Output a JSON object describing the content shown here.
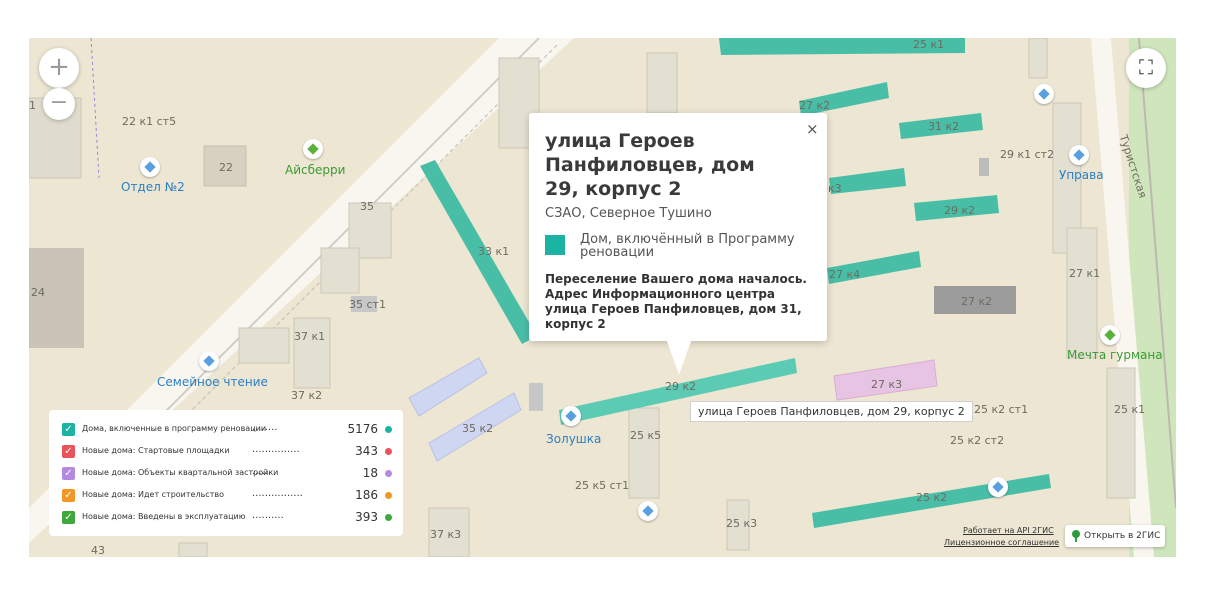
{
  "popup": {
    "title": "улица Героев Панфиловцев, дом 29, корпус 2",
    "district": "СЗАО, Северное Тушино",
    "status": "Дом, включённый в Программу реновации",
    "info": "Переселение Вашего дома началось. Адрес Информационного центра улица Героев Панфиловцев, дом 31, корпус 2",
    "close_label": "×",
    "swatch_color": "#1bb3a4"
  },
  "hover_label": "улица Героев Панфиловцев, дом 29, корпус 2",
  "controls": {
    "zoom_in": "+",
    "zoom_out": "−",
    "fullscreen": "⛶"
  },
  "legend": [
    {
      "label": "Дома, включенные в программу реновации",
      "dots": "........",
      "count": "5176",
      "color": "#1bb3a4",
      "checkbox_color": "#1bb3a4"
    },
    {
      "label": "Новые дома: Стартовые площадки",
      "dots": "...............",
      "count": "343",
      "color": "#e9545b",
      "checkbox_color": "#e9545b"
    },
    {
      "label": "Новые дома: Объекты квартальной застройки",
      "dots": "......",
      "count": "18",
      "color": "#b48ae0",
      "checkbox_color": "#b48ae0"
    },
    {
      "label": "Новые дома: Идет строительство",
      "dots": "................",
      "count": "186",
      "color": "#f29624",
      "checkbox_color": "#f29624"
    },
    {
      "label": "Новые дома: Введены в эксплуатацию",
      "dots": "..........",
      "count": "393",
      "color": "#3ea83a",
      "checkbox_color": "#3ea83a"
    }
  ],
  "attribution": {
    "api": "Работает на API 2ГИС",
    "license": "Лицензионное соглашение",
    "open_button": "Открыть в 2ГИС"
  },
  "map_labels": {
    "otdel": "Отдел №2",
    "aysberri": "Айсберри",
    "semeynoe": "Семейное чтение",
    "zolushka": "Золушка",
    "uprava": "Управа",
    "mechta": "Мечта гурмана",
    "street": "Туристская",
    "b_22k1st5": "22 к1 ст5",
    "b_22": "22",
    "b_35": "35",
    "b_35st1": "35 ст1",
    "b_33k1": "33 к1",
    "b_37k1": "37 к1",
    "b_37k2": "37 к2",
    "b_35k2": "35 к2",
    "b_24": "24",
    "b_29k2": "29 к2",
    "b_25k5": "25 к5",
    "b_25k5st1": "25 к5 ст1",
    "b_25k3": "25 к3",
    "b_37k3": "37 к3",
    "b_43": "43",
    "b_25k1_top": "25 к1",
    "b_27k2": "27 к2",
    "b_31k2": "31 к2",
    "b_29k1st2": "29 к1 ст2",
    "b_k3": "к3",
    "b_29k2b": "29 к2",
    "b_27k4": "27 к4",
    "b_27k2b": "27 к2",
    "b_27k1": "27 к1",
    "b_27k3": "27 к3",
    "b_25k2st1": "25 к2 ст1",
    "b_25k2st2": "25 к2 ст2",
    "b_25k2": "25 к2",
    "b_25k1": "25 к1",
    "b_1": "1"
  }
}
